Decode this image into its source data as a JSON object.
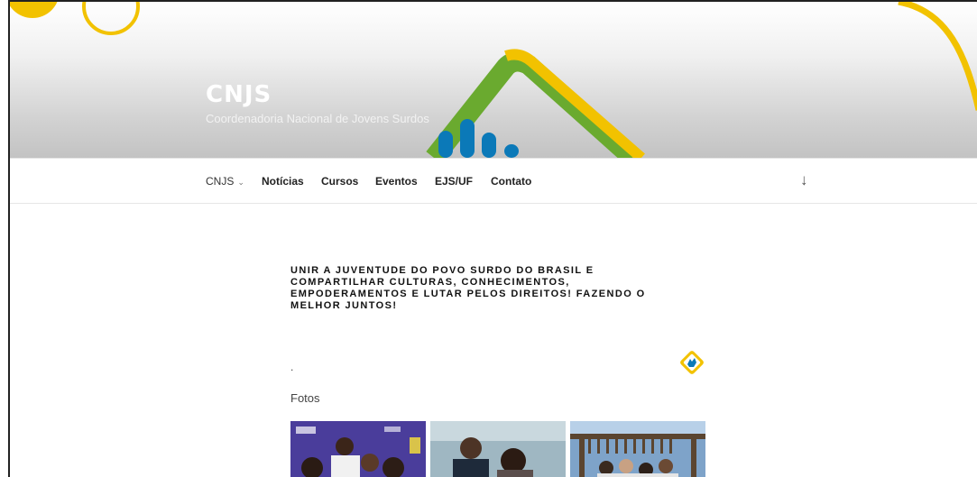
{
  "header": {
    "site_title": "CNJS",
    "site_description": "Coordenadoria Nacional de Jovens Surdos"
  },
  "nav": {
    "items": [
      {
        "label": "CNJS"
      },
      {
        "label": "Notícias"
      },
      {
        "label": "Cursos"
      },
      {
        "label": "Eventos"
      },
      {
        "label": "EJS/UF"
      },
      {
        "label": "Contato"
      }
    ],
    "chevron": "⌄",
    "scroll_down": "↓"
  },
  "content": {
    "tagline": "Unir a juventude do Povo Surdo do Brasil e compartilhar culturas, conhecimentos, empoderamentos e lutar pelos direitos! Fazendo o melhor juntos!",
    "dot": ".",
    "gallery_heading": "Fotos"
  },
  "colors": {
    "yellow": "#f2c200",
    "green": "#6aaa2f",
    "blue": "#0b79b8"
  },
  "icons": [
    "chevron-down-icon",
    "arrow-down-icon",
    "accessibility-hand-icon"
  ]
}
